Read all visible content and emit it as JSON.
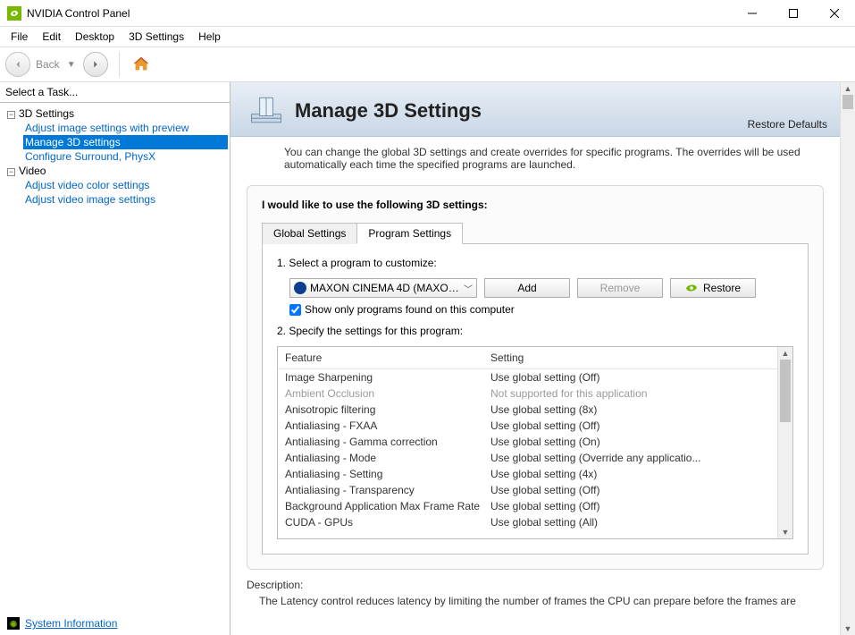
{
  "window": {
    "title": "NVIDIA Control Panel"
  },
  "menu": {
    "file": "File",
    "edit": "Edit",
    "desktop": "Desktop",
    "settings3d": "3D Settings",
    "help": "Help"
  },
  "toolbar": {
    "back_label": "Back"
  },
  "sidebar": {
    "header": "Select a Task...",
    "cat1": "3D Settings",
    "cat1_items": {
      "a": "Adjust image settings with preview",
      "b": "Manage 3D settings",
      "c": "Configure Surround, PhysX"
    },
    "cat2": "Video",
    "cat2_items": {
      "a": "Adjust video color settings",
      "b": "Adjust video image settings"
    },
    "sysinfo": "System Information"
  },
  "page": {
    "title": "Manage 3D Settings",
    "restore_defaults": "Restore Defaults",
    "intro": "You can change the global 3D settings and create overrides for specific programs. The overrides will be used automatically each time the specified programs are launched.",
    "panel_title": "I would like to use the following 3D settings:",
    "tabs": {
      "global": "Global Settings",
      "program": "Program Settings"
    },
    "step1": "1. Select a program to customize:",
    "program_combo": "MAXON CINEMA 4D (MAXON CI...",
    "btn_add": "Add",
    "btn_remove": "Remove",
    "btn_restore": "Restore",
    "chk_showonly": "Show only programs found on this computer",
    "step2": "2. Specify the settings for this program:",
    "col_feature": "Feature",
    "col_setting": "Setting",
    "rows": [
      {
        "f": "Image Sharpening",
        "s": "Use global setting (Off)",
        "dim": false
      },
      {
        "f": "Ambient Occlusion",
        "s": "Not supported for this application",
        "dim": true
      },
      {
        "f": "Anisotropic filtering",
        "s": "Use global setting (8x)",
        "dim": false
      },
      {
        "f": "Antialiasing - FXAA",
        "s": "Use global setting (Off)",
        "dim": false
      },
      {
        "f": "Antialiasing - Gamma correction",
        "s": "Use global setting (On)",
        "dim": false
      },
      {
        "f": "Antialiasing - Mode",
        "s": "Use global setting (Override any applicatio...",
        "dim": false
      },
      {
        "f": "Antialiasing - Setting",
        "s": "Use global setting (4x)",
        "dim": false
      },
      {
        "f": "Antialiasing - Transparency",
        "s": "Use global setting (Off)",
        "dim": false
      },
      {
        "f": "Background Application Max Frame Rate",
        "s": "Use global setting (Off)",
        "dim": false
      },
      {
        "f": "CUDA - GPUs",
        "s": "Use global setting (All)",
        "dim": false
      }
    ],
    "desc_label": "Description:",
    "desc_text": "The Latency control reduces latency by limiting the number of frames the CPU can prepare before the frames are"
  }
}
